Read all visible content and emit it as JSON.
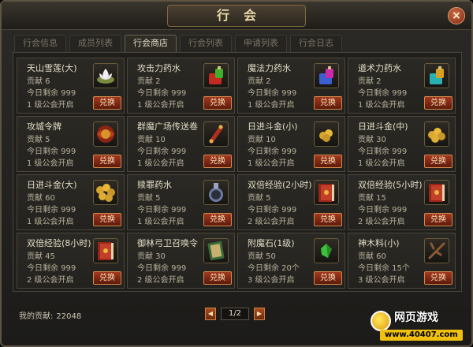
{
  "window": {
    "title": "行会",
    "close_label": "×"
  },
  "tabs": [
    {
      "label": "行会信息",
      "active": false
    },
    {
      "label": "成员列表",
      "active": false
    },
    {
      "label": "行会商店",
      "active": true
    },
    {
      "label": "行会列表",
      "active": false
    },
    {
      "label": "申请列表",
      "active": false
    },
    {
      "label": "行会日志",
      "active": false
    }
  ],
  "items": [
    {
      "name": "天山雪莲(大)",
      "contrib": "贡献 6",
      "remain": "今日剩余 999",
      "req": "1 级公会开启",
      "icon": "lotus-icon",
      "button": "兑换"
    },
    {
      "name": "攻击力药水",
      "contrib": "贡献 2",
      "remain": "今日剩余 999",
      "req": "1 级公会开启",
      "icon": "attack-potion-icon",
      "button": "兑换"
    },
    {
      "name": "魔法力药水",
      "contrib": "贡献 2",
      "remain": "今日剩余 999",
      "req": "1 级公会开启",
      "icon": "magic-potion-icon",
      "button": "兑换"
    },
    {
      "name": "道术力药水",
      "contrib": "贡献 2",
      "remain": "今日剩余 999",
      "req": "1 级公会开启",
      "icon": "taoist-potion-icon",
      "button": "兑换"
    },
    {
      "name": "攻城令牌",
      "contrib": "贡献 5",
      "remain": "今日剩余 999",
      "req": "1 级公会开启",
      "icon": "siege-token-icon",
      "button": "兑换"
    },
    {
      "name": "群魔广场传送卷",
      "contrib": "贡献 10",
      "remain": "今日剩余 999",
      "req": "1 级公会开启",
      "icon": "scroll-icon",
      "button": "兑换"
    },
    {
      "name": "日进斗金(小)",
      "contrib": "贡献 10",
      "remain": "今日剩余 999",
      "req": "1 级公会开启",
      "icon": "gold-coins-small-icon",
      "button": "兑换"
    },
    {
      "name": "日进斗金(中)",
      "contrib": "贡献 30",
      "remain": "今日剩余 999",
      "req": "1 级公会开启",
      "icon": "gold-coins-medium-icon",
      "button": "兑换"
    },
    {
      "name": "日进斗金(大)",
      "contrib": "贡献 60",
      "remain": "今日剩余 999",
      "req": "1 级公会开启",
      "icon": "gold-coins-large-icon",
      "button": "兑换"
    },
    {
      "name": "赎罪药水",
      "contrib": "贡献 5",
      "remain": "今日剩余 999",
      "req": "1 级公会开启",
      "icon": "redemption-potion-icon",
      "button": "兑换"
    },
    {
      "name": "双倍经验(2小时)",
      "contrib": "贡献 5",
      "remain": "今日剩余 999",
      "req": "2 级公会开启",
      "icon": "exp-book-icon",
      "button": "兑换"
    },
    {
      "name": "双倍经验(5小时)",
      "contrib": "贡献 15",
      "remain": "今日剩余 999",
      "req": "2 级公会开启",
      "icon": "exp-book-icon",
      "button": "兑换"
    },
    {
      "name": "双倍经验(8小时)",
      "contrib": "贡献 45",
      "remain": "今日剩余 999",
      "req": "2 级公会开启",
      "icon": "exp-book-icon",
      "button": "兑换"
    },
    {
      "name": "御林弓卫召唤令",
      "contrib": "贡献 30",
      "remain": "今日剩余 999",
      "req": "2 级公会开启",
      "icon": "summon-order-icon",
      "button": "兑换"
    },
    {
      "name": "附魔石(1级)",
      "contrib": "贡献 50",
      "remain": "今日剩余 20个",
      "req": "3 级公会开启",
      "icon": "enchant-stone-icon",
      "button": "兑换"
    },
    {
      "name": "神木料(小)",
      "contrib": "贡献 60",
      "remain": "今日剩余 15个",
      "req": "3 级公会开启",
      "icon": "wood-branch-icon",
      "button": "兑换"
    }
  ],
  "footer": {
    "contribution_label": "我的贡献:",
    "contribution_value": "22048",
    "page": "1/2",
    "prev_label": "◀",
    "next_label": "▶"
  },
  "watermark": {
    "text": "网页游戏",
    "url": "www.40407.com"
  }
}
